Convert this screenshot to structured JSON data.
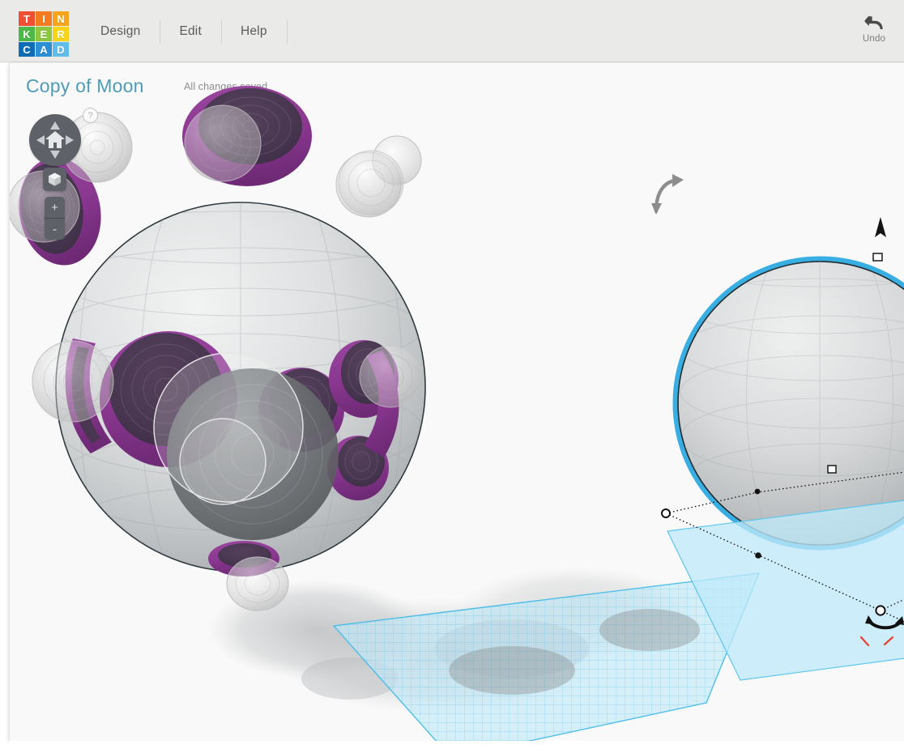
{
  "app": {
    "name": "Tinkercad",
    "logo_tiles": [
      {
        "letter": "T",
        "color": "#ef4f33"
      },
      {
        "letter": "I",
        "color": "#f47b20"
      },
      {
        "letter": "N",
        "color": "#f7a41d"
      },
      {
        "letter": "K",
        "color": "#4cb848"
      },
      {
        "letter": "E",
        "color": "#8dc63f"
      },
      {
        "letter": "R",
        "color": "#f7d417"
      },
      {
        "letter": "C",
        "color": "#0d6cb5"
      },
      {
        "letter": "A",
        "color": "#2a8fd4"
      },
      {
        "letter": "D",
        "color": "#60bce8"
      }
    ]
  },
  "menu": {
    "items": [
      {
        "label": "Design",
        "name": "menu-design"
      },
      {
        "label": "Edit",
        "name": "menu-edit"
      },
      {
        "label": "Help",
        "name": "menu-help"
      }
    ]
  },
  "toolbar": {
    "undo_label": "Undo",
    "undo_icon": "undo-arrow-icon"
  },
  "document": {
    "title": "Copy of Moon",
    "status": "All changes saved",
    "title_color": "#4e9cb5",
    "status_color": "#8e8e8e"
  },
  "viewcube": {
    "help_badge": "?",
    "home_icon": "home-icon",
    "arrow_up_icon": "triangle-up-icon",
    "arrow_down_icon": "triangle-down-icon",
    "arrow_left_icon": "triangle-left-icon",
    "arrow_right_icon": "triangle-right-icon",
    "fit_view_icon": "cube-icon",
    "zoom_in_label": "+",
    "zoom_out_label": "-",
    "widget_color": "#5e6268"
  },
  "viewport": {
    "background_color": "#f9f9f9",
    "workplane_color": "#6ecff0",
    "workplane_fill": "#bfe9f8",
    "selection_outline_color": "#2eaae1",
    "shape_grey": "#d3d5d6",
    "shape_grey_dark": "#6e7276",
    "crater_purple": "#8e3a92",
    "crater_dark": "#4c3850",
    "shadow_color": "#b9babb",
    "handle_fill": "#ffffff",
    "handle_stroke": "#111111",
    "red_marker_color": "#e8412f",
    "objects": [
      {
        "name": "moon-sphere",
        "type": "solid-sphere",
        "color": "#d3d5d6"
      },
      {
        "name": "crater-holes",
        "type": "hole-spheres",
        "color": "transparent-grey"
      },
      {
        "name": "crater-rings",
        "type": "purple-tori",
        "color": "#8e3a92"
      },
      {
        "name": "selected-sphere",
        "type": "solid-sphere",
        "color": "#d3d5d6",
        "selected": true
      }
    ],
    "rotate_handle_icon": "curved-rotate-arrow-icon",
    "height_handle_icon": "cone-up-arrow-icon",
    "plane_rotate_icon": "curved-rotate-arrow-icon"
  }
}
